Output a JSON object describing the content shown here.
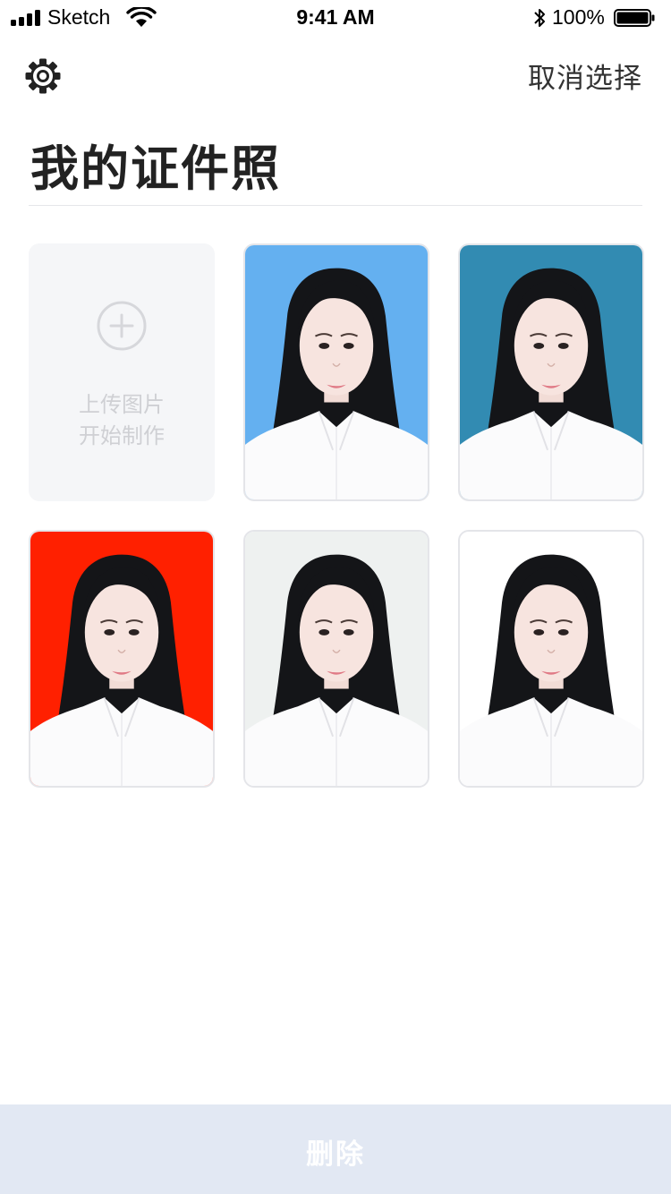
{
  "status_bar": {
    "carrier": "Sketch",
    "time": "9:41 AM",
    "battery": "100%"
  },
  "header": {
    "settings_icon": "gear-icon",
    "cancel_select_label": "取消选择"
  },
  "page": {
    "title": "我的证件照"
  },
  "upload_card": {
    "icon": "plus-circle-icon",
    "line1": "上传图片",
    "line2": "开始制作"
  },
  "photos": [
    {
      "background": "#64b0f0"
    },
    {
      "background": "#328bb2"
    },
    {
      "background": "#ff2000"
    },
    {
      "background": "#eef1f0"
    },
    {
      "background": "#ffffff"
    }
  ],
  "footer": {
    "delete_label": "删除"
  }
}
